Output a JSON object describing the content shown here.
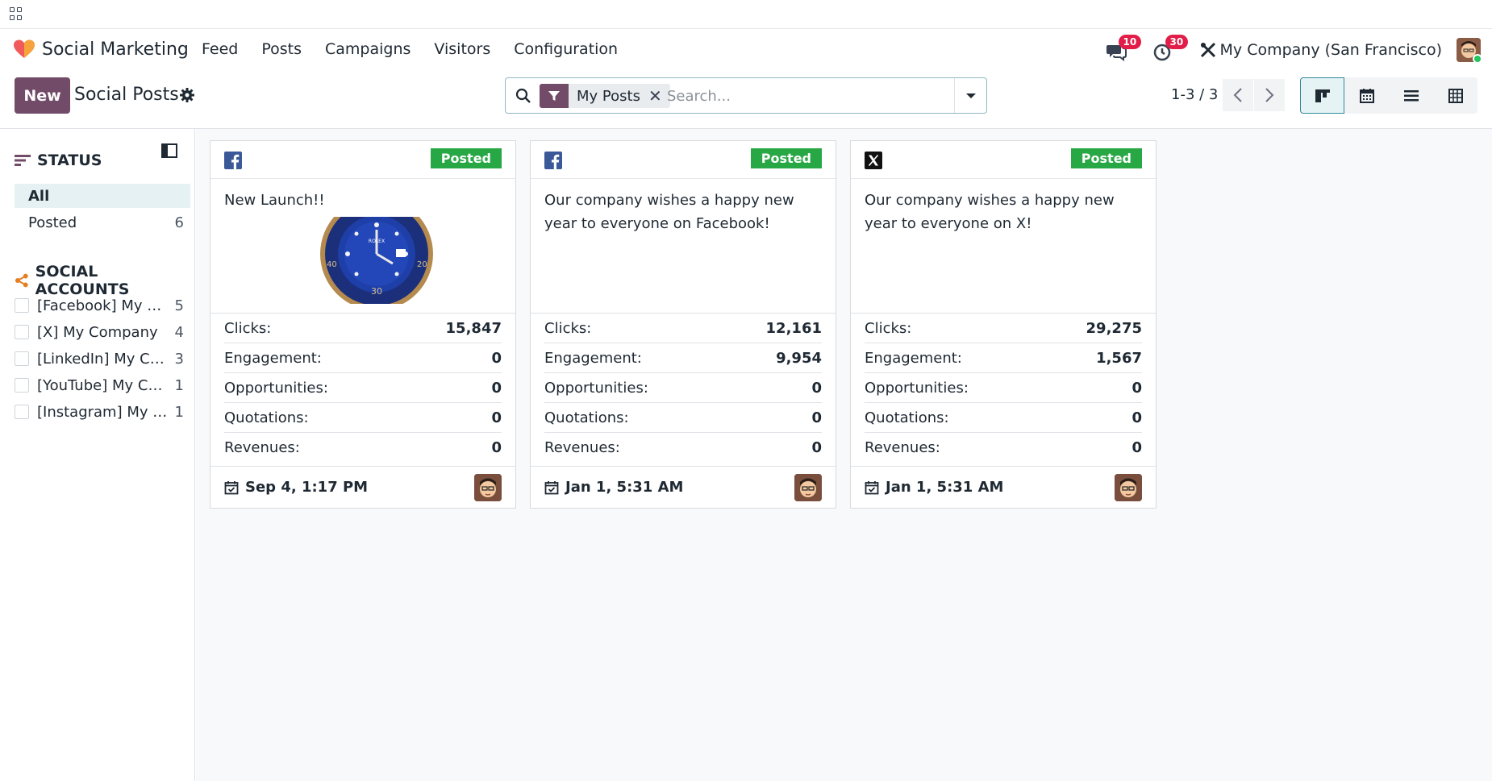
{
  "navbar": {
    "app_name": "Social Marketing",
    "menu": [
      "Feed",
      "Posts",
      "Campaigns",
      "Visitors",
      "Configuration"
    ],
    "messages_count": "10",
    "activities_count": "30",
    "company": "My Company (San Francisco)"
  },
  "control": {
    "new_label": "New",
    "title": "Social Posts",
    "facet_label": "My Posts",
    "search_placeholder": "Search...",
    "pager": "1-3 / 3"
  },
  "sidebar": {
    "status_title": "STATUS",
    "status_all": "All",
    "status_posted": "Posted",
    "status_posted_count": "6",
    "accounts_title": "SOCIAL ACCOUNTS",
    "accounts": [
      {
        "label": "[Facebook] My Company",
        "count": "5"
      },
      {
        "label": "[X] My Company",
        "count": "4"
      },
      {
        "label": "[LinkedIn] My Company",
        "count": "3"
      },
      {
        "label": "[YouTube] My Company",
        "count": "1"
      },
      {
        "label": "[Instagram] My Company",
        "count": "1"
      }
    ]
  },
  "stat_labels": {
    "clicks": "Clicks:",
    "engagement": "Engagement:",
    "opportunities": "Opportunities:",
    "quotations": "Quotations:",
    "revenues": "Revenues:"
  },
  "cards": [
    {
      "network": "facebook",
      "status": "Posted",
      "message": "New Launch!!",
      "clicks": "15,847",
      "engagement": "0",
      "opportunities": "0",
      "quotations": "0",
      "revenues": "0",
      "date": "Sep 4, 1:17 PM"
    },
    {
      "network": "facebook",
      "status": "Posted",
      "message": "Our company wishes a happy new year to everyone on Facebook!",
      "clicks": "12,161",
      "engagement": "9,954",
      "opportunities": "0",
      "quotations": "0",
      "revenues": "0",
      "date": "Jan 1, 5:31 AM"
    },
    {
      "network": "x",
      "status": "Posted",
      "message": "Our company wishes a happy new year to everyone on X!",
      "clicks": "29,275",
      "engagement": "1,567",
      "opportunities": "0",
      "quotations": "0",
      "revenues": "0",
      "date": "Jan 1, 5:31 AM"
    }
  ],
  "colors": {
    "brand": "#714b67",
    "posted": "#28a745",
    "facebook": "#3b5998",
    "badge": "#e11d48"
  }
}
